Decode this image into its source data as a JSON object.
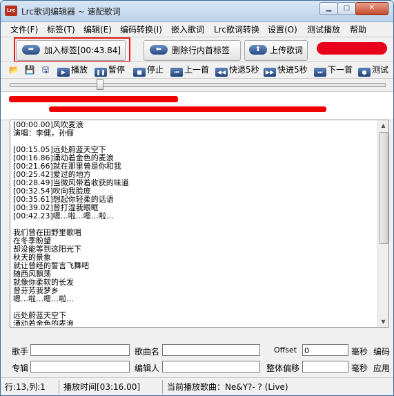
{
  "window": {
    "title": "Lrc歌词编辑器 ~ 速配歌词",
    "icon_label": "Lrc",
    "min_icon": "minimize-icon",
    "max_icon": "maximize-icon",
    "close_icon": "close-icon"
  },
  "menu": [
    "文件(F)",
    "标签(T)",
    "编辑(E)",
    "编码转换(I)",
    "嵌入歌词",
    "Lrc歌词转换",
    "设置(O)",
    "测试播放",
    "帮助"
  ],
  "toolbar": {
    "add_tag": "加入标签[00:43.84]",
    "delete_tag": "删除行内首标签",
    "upload": "上传歌词",
    "highlight_color": "#e21b1b",
    "redacted_color": "#e8001b"
  },
  "playback": {
    "play": "播放",
    "pause": "暂停",
    "stop": "停止",
    "prev": "上一首",
    "rewind": "快退5秒",
    "forward": "快进5秒",
    "next": "下一首",
    "test": "测试"
  },
  "progress": 0.24,
  "editor_lines": [
    "[00:00.00]风吹麦浪",
    "演唱：李健，孙俪",
    "",
    "[00:15.05]远处蔚蓝天空下",
    "[00:16.86]涌动着金色的麦浪",
    "[00:21.66]就在那里曾是你和我",
    "[00:25.42]爱过的地方",
    "[00:28.49]当微风带着收获的味道",
    "[00:32.54]吹向我脸庞",
    "[00:35.61]想起你轻柔的话语",
    "[00:39.02]曾打湿我眼眶",
    "[00:42.23]嗯…啦…嗯…啦…",
    "",
    "我们曾在田野里歌唱",
    "在冬季盼望",
    "却没能等到这阳光下",
    "秋天的景象",
    "就让曾经的誓言飞舞吧",
    "随西风飘荡",
    "就像你柔软的长发",
    "曾芬芳我梦乡",
    "嗯…啦…嗯…啦…",
    "",
    "远处蔚蓝天空下",
    "涌动着金色的麦浪"
  ],
  "fields": {
    "singer": "歌手",
    "song": "歌曲名",
    "offset": "Offset",
    "offset_value": "0",
    "ms": "毫秒",
    "encoding": "编码",
    "album": "专辑",
    "editor": "编辑人",
    "global_offset": "整体偏移",
    "ms2": "毫秒",
    "apply": "应用"
  },
  "status": {
    "position": "行:13,列:1",
    "play_time": "播放时间[03:16.00]",
    "now_playing": "当前播放歌曲：Ne&Y?- ?  (Live)"
  }
}
